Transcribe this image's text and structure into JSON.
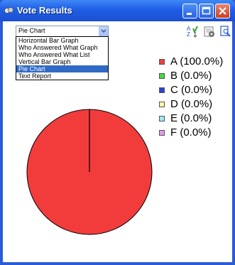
{
  "window": {
    "title": "Vote Results"
  },
  "toolbar": {
    "select_value": "Pie Chart",
    "options": [
      "Horizontal Bar Graph",
      "Who Answered What Graph",
      "Who Answered What List",
      "Vertical Bar Graph",
      "Pie Chart",
      "Text Report"
    ],
    "tools": [
      "sort-icon",
      "export-icon",
      "print-preview-icon"
    ]
  },
  "chart_data": {
    "type": "pie",
    "categories": [
      "A",
      "B",
      "C",
      "D",
      "E",
      "F"
    ],
    "values": [
      100.0,
      0.0,
      0.0,
      0.0,
      0.0,
      0.0
    ],
    "legend": [
      "A (100.0%)",
      "B (0.0%)",
      "C (0.0%)",
      "D (0.0%)",
      "E (0.0%)",
      "F (0.0%)"
    ],
    "colors": [
      "#f23c3c",
      "#3fdc3f",
      "#2b3fd6",
      "#f7f7a8",
      "#9ee8ee",
      "#e59be7"
    ],
    "legend_position": "right"
  }
}
